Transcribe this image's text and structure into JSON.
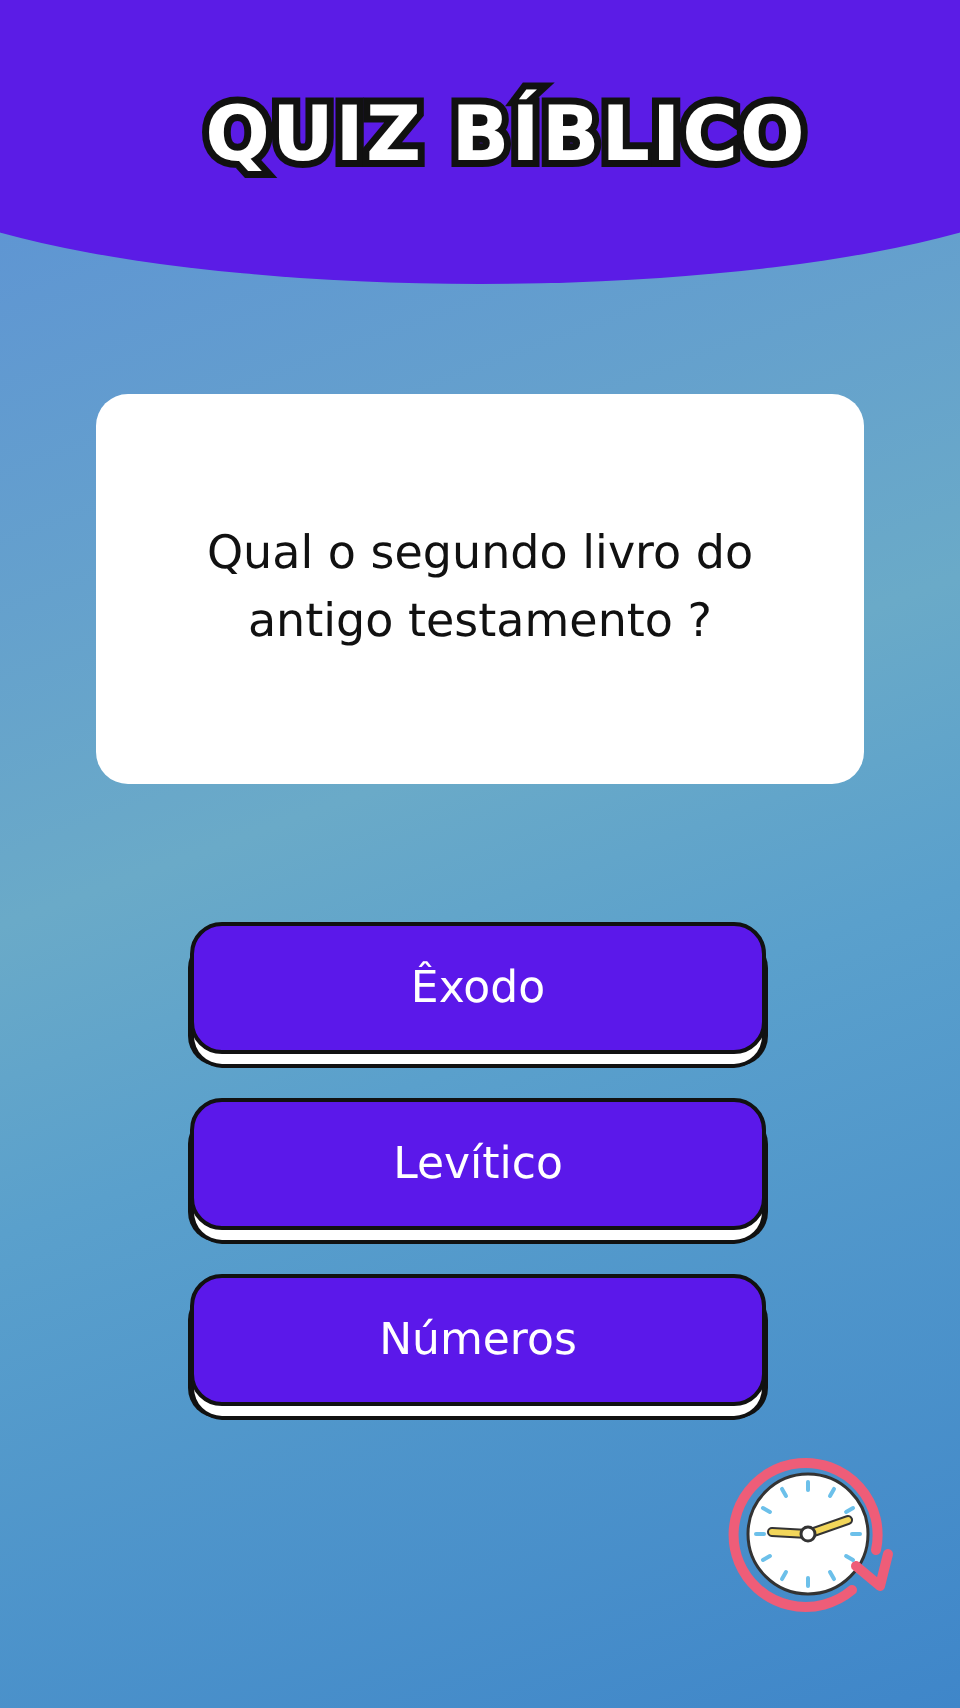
{
  "header": {
    "title": "QUIZ BÍBLICO"
  },
  "question": {
    "text": "Qual o segundo livro do antigo testamento ?"
  },
  "answers": [
    {
      "label": "Êxodo"
    },
    {
      "label": "Levítico"
    },
    {
      "label": "Números"
    }
  ]
}
